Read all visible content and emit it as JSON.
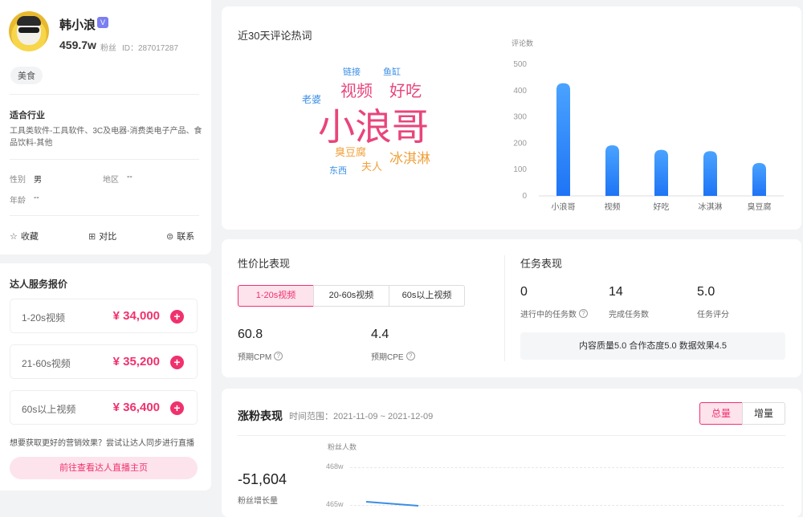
{
  "profile": {
    "name": "韩小浪",
    "vip_badge": "V",
    "fans_count": "459.7w",
    "fans_label": "粉丝",
    "id_text": "ID：287017287",
    "tag": "美食",
    "industry_title": "适合行业",
    "industry_text": "工具类软件-工具软件、3C及电器-消费类电子产品、食品饮料-其他",
    "gender_label": "性别",
    "gender_value": "男",
    "region_label": "地区",
    "region_value": "--",
    "age_label": "年龄",
    "age_value": "--",
    "actions": {
      "favorite": "收藏",
      "compare": "对比",
      "contact": "联系"
    }
  },
  "pricing": {
    "title": "达人服务报价",
    "rows": [
      {
        "label": "1-20s视频",
        "price": "¥ 34,000"
      },
      {
        "label": "21-60s视频",
        "price": "¥ 35,200"
      },
      {
        "label": "60s以上视频",
        "price": "¥ 36,400"
      }
    ],
    "live_hint": "想要获取更好的营销效果？尝试让达人同步进行直播",
    "live_button": "前往查看达人直播主页"
  },
  "hotwords": {
    "title": "近30天评论热词",
    "cloud": [
      {
        "text": "链接",
        "color": "#3a8ee6"
      },
      {
        "text": "鱼缸",
        "color": "#3a8ee6"
      },
      {
        "text": "视频",
        "color": "#e8457a"
      },
      {
        "text": "好吃",
        "color": "#e8457a"
      },
      {
        "text": "老婆",
        "color": "#3a8ee6"
      },
      {
        "text": "小浪哥",
        "color": "#e8457a"
      },
      {
        "text": "臭豆腐",
        "color": "#f0a03a"
      },
      {
        "text": "冰淇淋",
        "color": "#f0a03a"
      },
      {
        "text": "夫人",
        "color": "#f0a03a"
      },
      {
        "text": "东西",
        "color": "#3a8ee6"
      }
    ]
  },
  "chart_data": {
    "type": "bar",
    "ylabel": "评论数",
    "categories": [
      "小浪哥",
      "视频",
      "好吃",
      "冰淇淋",
      "臭豆腐"
    ],
    "values": [
      428,
      192,
      175,
      170,
      125
    ],
    "ylim": [
      0,
      500
    ],
    "yticks": [
      0,
      100,
      200,
      300,
      400,
      500
    ],
    "bar_color_top": "#4aa3ff",
    "bar_color_bottom": "#1e74f5",
    "grid": false
  },
  "cost": {
    "title": "性价比表现",
    "tabs": [
      "1-20s视频",
      "20-60s视频",
      "60s以上视频"
    ],
    "active_tab": 0,
    "cpm_value": "60.8",
    "cpm_label": "预期CPM",
    "cpe_value": "4.4",
    "cpe_label": "预期CPE"
  },
  "tasks": {
    "title": "任务表现",
    "in_progress_value": "0",
    "in_progress_label": "进行中的任务数",
    "completed_value": "14",
    "completed_label": "完成任务数",
    "score_value": "5.0",
    "score_label": "任务评分",
    "summary": "内容质量5.0 合作态度5.0 数据效果4.5"
  },
  "growth": {
    "title": "涨粉表现",
    "time_range": "时间范围：2021-11-09 ~ 2021-12-09",
    "toggle_total": "总量",
    "toggle_increment": "增量",
    "active_toggle": "total",
    "change_value": "-51,604",
    "change_label": "粉丝增长量",
    "axis_title": "粉丝人数",
    "ticks": [
      "468w",
      "465w"
    ],
    "line_color": "#3a8ee6"
  },
  "colors": {
    "accent": "#f0316e",
    "accent_light": "#fde3ec",
    "blue": "#3a8ee6"
  }
}
